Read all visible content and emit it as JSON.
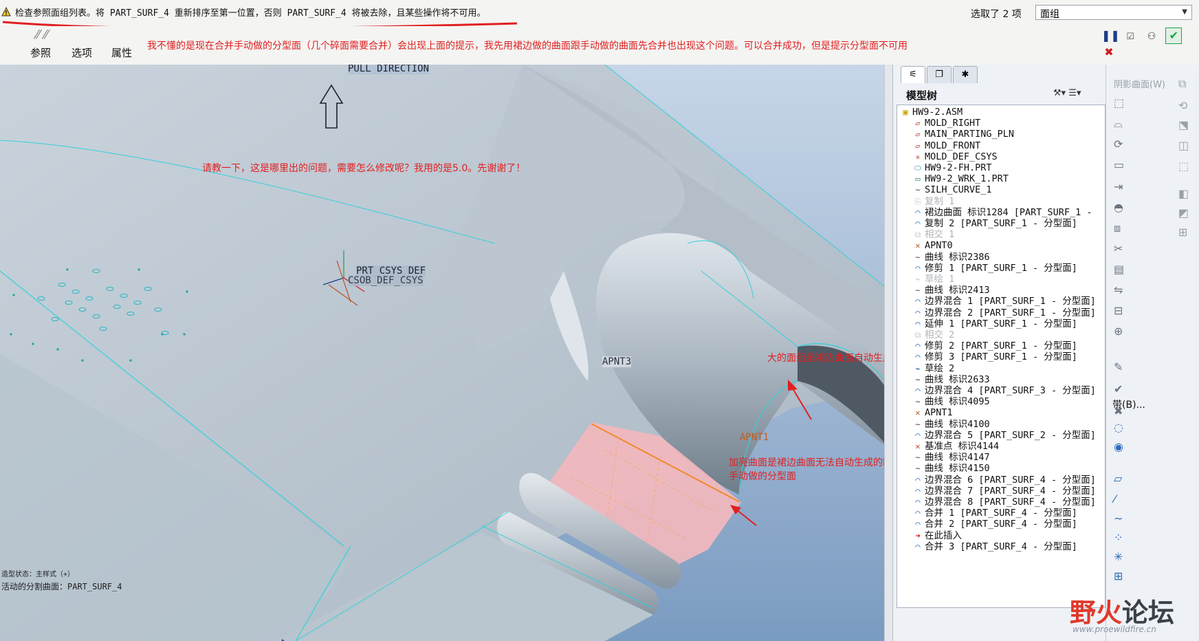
{
  "message_bar": {
    "text": "检查参照面组列表。将 PART_SURF_4 重新排序至第一位置，否则 PART_SURF_4 将被去除，且某些操作将不可用。",
    "selection_label": "选取了 2 项",
    "selection_value": "面组"
  },
  "dashboard": {
    "tabs": [
      "参照",
      "选项",
      "属性"
    ],
    "annotation": "我不懂的是现在合并手动做的分型面（几个碎面需要合并）会出现上面的提示，我先用裙边做的曲面跟手动做的曲面先合并也出现这个问题。可以合并成功，但是提示分型面不可用"
  },
  "viewport": {
    "pull_direction": "PULL DIRECTION",
    "csys_label_1": "PRT_CSYS_DEF",
    "csys_label_2": "CSOB_DEF_CSYS",
    "point_apnt3": "APNT3",
    "point_apnt1": "APNT1",
    "note_question": "请教一下，这是哪里出的问题，需要怎么修改呢？我用的是5.0。先谢谢了！",
    "note_big_quilt": "大的面组是裙边曲面自动生成的",
    "note_highlight_1": "加亮曲面是裙边曲面无法自动生成的区域",
    "note_highlight_2": "手动做的分型面",
    "status_line_1": "造型状态：主样式（+）",
    "status_line_2": "活动的分割曲面：PART_SURF_4"
  },
  "model_tree": {
    "title": "模型树",
    "items": [
      {
        "label": "HW9-2.ASM",
        "icon": "assembly-icon",
        "dim": false
      },
      {
        "label": "MOLD_RIGHT",
        "icon": "datum-plane-icon",
        "dim": false
      },
      {
        "label": "MAIN_PARTING_PLN",
        "icon": "datum-plane-icon",
        "dim": false
      },
      {
        "label": "MOLD_FRONT",
        "icon": "datum-plane-icon",
        "dim": false
      },
      {
        "label": "MOLD_DEF_CSYS",
        "icon": "csys-icon",
        "dim": false
      },
      {
        "label": "HW9-2-FH.PRT",
        "icon": "part-icon",
        "dim": false
      },
      {
        "label": "HW9-2_WRK_1.PRT",
        "icon": "workpiece-icon",
        "dim": false
      },
      {
        "label": "SILH_CURVE_1",
        "icon": "curve-icon",
        "dim": false
      },
      {
        "label": "复制 1",
        "icon": "copy-icon",
        "dim": true
      },
      {
        "label": "裙边曲面 标识1284 [PART_SURF_1 -",
        "icon": "surface-icon",
        "dim": false
      },
      {
        "label": "复制 2 [PART_SURF_1 - 分型面]",
        "icon": "surface-icon",
        "dim": false
      },
      {
        "label": "相交 1",
        "icon": "intersect-icon",
        "dim": true
      },
      {
        "label": "APNT0",
        "icon": "datum-point-icon",
        "dim": false
      },
      {
        "label": "曲线 标识2386",
        "icon": "curve-icon",
        "dim": false
      },
      {
        "label": "修剪 1 [PART_SURF_1 - 分型面]",
        "icon": "surface-icon",
        "dim": false
      },
      {
        "label": "草绘 1",
        "icon": "sketch-icon",
        "dim": true
      },
      {
        "label": "曲线 标识2413",
        "icon": "curve-icon",
        "dim": false
      },
      {
        "label": "边界混合 1 [PART_SURF_1 - 分型面]",
        "icon": "surface-icon",
        "dim": false
      },
      {
        "label": "边界混合 2 [PART_SURF_1 - 分型面]",
        "icon": "surface-icon",
        "dim": false
      },
      {
        "label": "延伸 1 [PART_SURF_1 - 分型面]",
        "icon": "surface-icon",
        "dim": false
      },
      {
        "label": "相交 2",
        "icon": "intersect-icon",
        "dim": true
      },
      {
        "label": "修剪 2 [PART_SURF_1 - 分型面]",
        "icon": "surface-icon",
        "dim": false
      },
      {
        "label": "修剪 3 [PART_SURF_1 - 分型面]",
        "icon": "surface-icon",
        "dim": false
      },
      {
        "label": "草绘 2",
        "icon": "sketch-icon",
        "dim": false
      },
      {
        "label": "曲线 标识2633",
        "icon": "curve-icon",
        "dim": false
      },
      {
        "label": "边界混合 4 [PART_SURF_3 - 分型面]",
        "icon": "surface-icon",
        "dim": false
      },
      {
        "label": "曲线 标识4095",
        "icon": "curve-icon",
        "dim": false
      },
      {
        "label": "APNT1",
        "icon": "datum-point-icon",
        "dim": false
      },
      {
        "label": "曲线 标识4100",
        "icon": "curve-icon",
        "dim": false
      },
      {
        "label": "边界混合 5 [PART_SURF_2 - 分型面]",
        "icon": "surface-icon",
        "dim": false
      },
      {
        "label": "基准点 标识4144",
        "icon": "datum-point-icon",
        "dim": false
      },
      {
        "label": "曲线 标识4147",
        "icon": "curve-icon",
        "dim": false
      },
      {
        "label": "曲线 标识4150",
        "icon": "curve-icon",
        "dim": false
      },
      {
        "label": "边界混合 6 [PART_SURF_4 - 分型面]",
        "icon": "surface-icon",
        "dim": false
      },
      {
        "label": "边界混合 7 [PART_SURF_4 - 分型面]",
        "icon": "surface-icon",
        "dim": false
      },
      {
        "label": "边界混合 8 [PART_SURF_4 - 分型面]",
        "icon": "surface-icon",
        "dim": false
      },
      {
        "label": "合并 1 [PART_SURF_4 - 分型面]",
        "icon": "surface-icon",
        "dim": false
      },
      {
        "label": "合并 2 [PART_SURF_4 - 分型面]",
        "icon": "surface-icon",
        "dim": false
      },
      {
        "label": "在此插入",
        "icon": "insert-arrow-icon",
        "dim": false
      },
      {
        "label": "合并 3 [PART_SURF_4 - 分型面]",
        "icon": "surface-icon",
        "dim": false
      }
    ]
  },
  "right_toolbar": {
    "title": "阴影曲面(W)",
    "band_label": "带(B)..."
  },
  "watermark": {
    "text": "野火论坛",
    "url": "www.proewildfire.cn"
  },
  "colors": {
    "annotation_red": "#e02020",
    "edge_cyan": "#34d0d8",
    "highlight_pink": "#f2b8bd",
    "accept_green": "#1aa34a",
    "cancel_red": "#d11a1a"
  }
}
